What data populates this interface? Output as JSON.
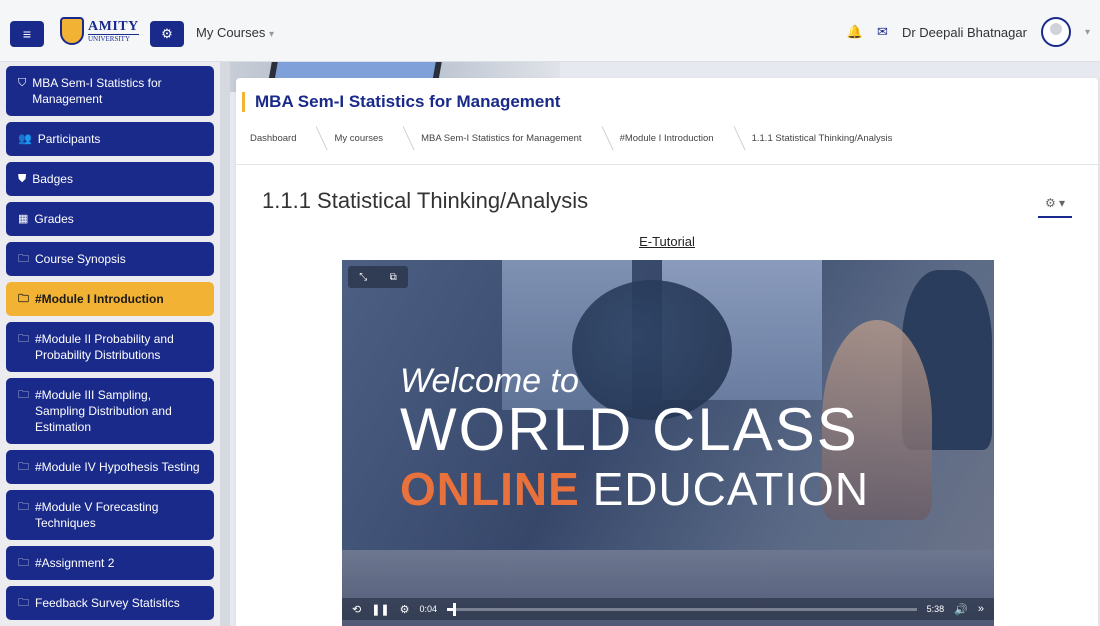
{
  "navbar": {
    "logo_line1": "AMITY",
    "logo_line2": "UNIVERSITY",
    "my_courses_label": "My Courses",
    "caret": "▾",
    "username": "Dr Deepali Bhatnagar",
    "icons": [
      "hamburger-icon",
      "gear-icon",
      "bell-icon",
      "envelope-icon",
      "avatar-icon"
    ],
    "accent_color": "#1a2a8a",
    "highlight_color": "#f2b233"
  },
  "sidebar": {
    "items": [
      {
        "icon": "⛉",
        "label": "MBA Sem-I Statistics for Management"
      },
      {
        "icon": "👥",
        "label": "Participants"
      },
      {
        "icon": "⛊",
        "label": "Badges"
      },
      {
        "icon": "▦",
        "label": "Grades"
      },
      {
        "icon": "🗀",
        "label": "Course Synopsis"
      },
      {
        "icon": "🗀",
        "label": "#Module I Introduction"
      },
      {
        "icon": "🗀",
        "label": "#Module II Probability and Probability Distributions"
      },
      {
        "icon": "🗀",
        "label": "#Module III Sampling, Sampling Distribution and Estimation"
      },
      {
        "icon": "🗀",
        "label": "#Module IV Hypothesis Testing"
      },
      {
        "icon": "🗀",
        "label": "#Module V Forecasting Techniques"
      },
      {
        "icon": "🗀",
        "label": "#Assignment 2"
      },
      {
        "icon": "🗀",
        "label": "Feedback Survey Statistics"
      }
    ],
    "active_index": 5
  },
  "main": {
    "course_title": "MBA Sem-I Statistics for Management",
    "breadcrumb": [
      "Dashboard",
      "My courses",
      "MBA Sem-I Statistics for Management",
      "#Module I Introduction",
      "1.1.1 Statistical Thinking/Analysis"
    ],
    "page_heading": "1.1.1 Statistical Thinking/Analysis",
    "gear_label": "⚙ ▾",
    "etutorial_link": "E-Tutorial"
  },
  "video": {
    "welcome": "Welcome to",
    "headline": "WORLD CLASS",
    "online": "ONLINE",
    "education": "EDUCATION",
    "current_time": "0:04",
    "duration": "5:38",
    "progress": 0.012,
    "accent_text_color": "#e8713c"
  }
}
